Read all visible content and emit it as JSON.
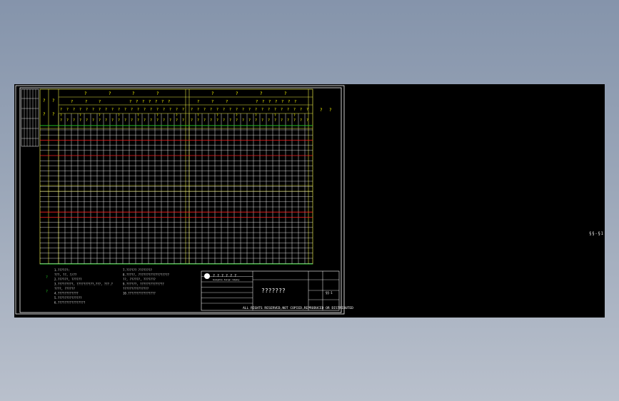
{
  "drawing": {
    "side_label": "§§-§1",
    "title_block": {
      "company": "? ? ? ? ? ?",
      "company_en": "Guangzhou design company",
      "title": "???????",
      "drawing_no": "§§-1",
      "rights_notice": "ALL RIGHTS RESERVED,NOT COPIED,REPRODUCED OR DISTRIBUTED"
    },
    "notes": [
      "1.??????:",
      "  ???,  ??,  ?/??",
      "2.??????,  ??????",
      "3.?????????, ??????????,???,  ???.?",
      "  ????,  ??????",
      "4.????????????",
      "5.??????????????",
      "6.????????????????"
    ],
    "notes_right": [
      "7.??????  ????????",
      "8.?????,  ??????????????????",
      "  ??,  ??????,  ???????",
      "9.??????,  ??????????????",
      "  ???????????????",
      "10.????????????????"
    ],
    "header_marks": "?"
  },
  "colors": {
    "background_top": "#8594ab",
    "canvas": "#000000",
    "frame": "#ffffff",
    "table_yellow": "#e5e543",
    "grid_white": "#ffffff",
    "red_rows": "#ff2020",
    "green_rows": "#22c022",
    "header_text": "#ffff00"
  }
}
